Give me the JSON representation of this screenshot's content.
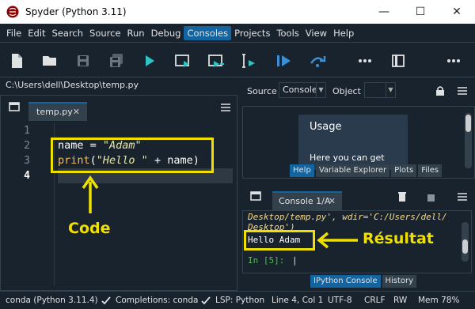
{
  "window": {
    "title": "Spyder (Python 3.11)",
    "minimize": "—",
    "maximize": "☐",
    "close": "✕"
  },
  "menu": [
    "File",
    "Edit",
    "Search",
    "Source",
    "Run",
    "Debug",
    "Consoles",
    "Projects",
    "Tools",
    "View",
    "Help"
  ],
  "active_menu": "Consoles",
  "toolbar": {
    "icons": [
      "new-file-icon",
      "open-folder-icon",
      "save-icon",
      "save-all-icon",
      "run-icon",
      "run-cell-icon",
      "run-cell-advance-icon",
      "run-selection-icon",
      "debug-icon",
      "step-over-icon",
      "more-options-icon",
      "panes-icon",
      "more-options-icon"
    ]
  },
  "editor": {
    "path": "C:\\Users\\dell\\Desktop\\temp.py",
    "tab_label": "temp.py",
    "tab_close": "✕",
    "line_numbers": [
      "1",
      "2",
      "3",
      "4"
    ],
    "code": {
      "l2_var": "name = ",
      "l2_str": "\"Adam\"",
      "l3_fn": "print",
      "l3_open": "(",
      "l3_str": "\"Hello \"",
      "l3_rest": " + name)"
    },
    "annotation": "Code"
  },
  "help_pane": {
    "source_label": "Source",
    "source_value": "Console",
    "object_label": "Object",
    "object_value": "",
    "card_title": "Usage",
    "card_text": "Here you can get",
    "tabs": [
      "Help",
      "Variable Explorer",
      "Plots",
      "Files"
    ],
    "active_tab": "Help"
  },
  "console": {
    "tab_label": "Console 1/A",
    "tab_close": "✕",
    "line1": "Desktop/temp.py', wdir='C:/Users/dell/",
    "line2": "Desktop')",
    "output": "Hello Adam",
    "prompt": "In [5]:",
    "annotation": "Résultat",
    "tabs": [
      "IPython Console",
      "History"
    ],
    "active_tab": "IPython Console"
  },
  "status": {
    "env": "conda (Python 3.11.4)",
    "completions": "Completions: conda",
    "lsp": "LSP: Python",
    "cursor": "Line 4, Col 1",
    "encoding": "UTF-8",
    "eol": "CRLF",
    "rw": "RW",
    "mem": "Mem 78%"
  },
  "colors": {
    "accent": "#1464a0",
    "annotation": "#f0e000",
    "background": "#19232d"
  }
}
